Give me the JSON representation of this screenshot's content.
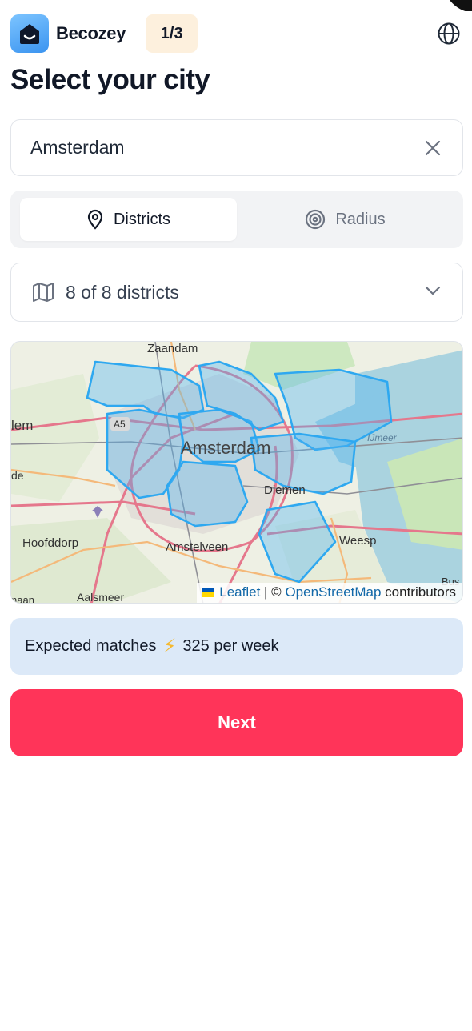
{
  "app": {
    "brand": "Becozey",
    "step": "1/3",
    "logo_icon": "smile-house-icon",
    "globe_icon": "globe-icon"
  },
  "page": {
    "title": "Select your city"
  },
  "city_input": {
    "value": "Amsterdam",
    "clear_icon": "close-icon"
  },
  "mode_toggle": {
    "options": [
      {
        "label": "Districts",
        "icon": "map-pin-icon",
        "active": true
      },
      {
        "label": "Radius",
        "icon": "target-icon",
        "active": false
      }
    ]
  },
  "district_select": {
    "label": "8 of 8 districts",
    "icon": "map-icon"
  },
  "map": {
    "place_labels": [
      "Zaandam",
      "Amsterdam",
      "Diemen",
      "Hoofddorp",
      "Amstelveen",
      "Weesp",
      "Aalsmeer",
      "IJmeer",
      "A5",
      "lem",
      "de",
      "Bus",
      "naan"
    ],
    "attribution": {
      "leaflet": "Leaflet",
      "separator": " | © ",
      "osm": "OpenStreetMap",
      "suffix": " contributors"
    }
  },
  "matches": {
    "prefix": "Expected matches",
    "icon": "⚡",
    "value": "325 per week"
  },
  "next_button": {
    "label": "Next"
  },
  "colors": {
    "accent": "#ff3459",
    "info_bg": "#dce9f8",
    "step_bg": "#fdf0dd",
    "district_stroke": "#2ea8f0"
  }
}
